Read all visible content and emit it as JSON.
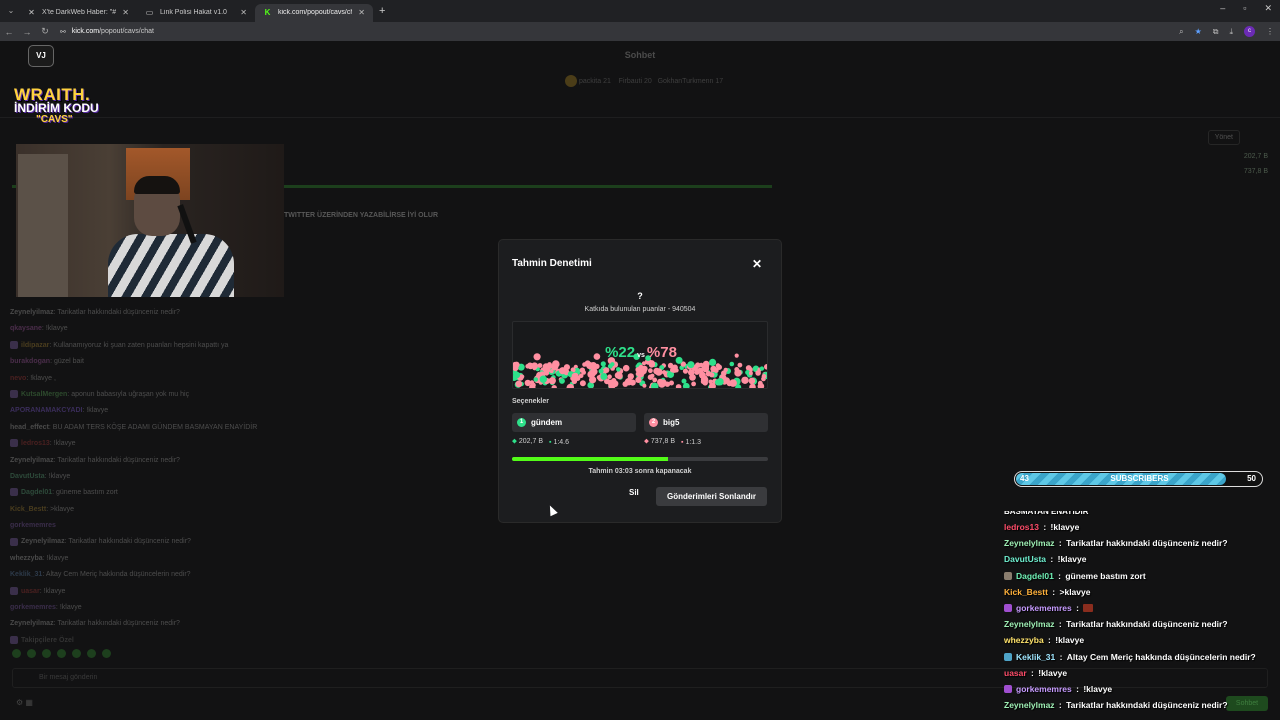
{
  "browser": {
    "tabs": [
      {
        "label": "X'te DarkWeb Haber: \"#UefaM",
        "icon": "x-logo-icon",
        "active": false
      },
      {
        "label": "Link Polisi Hakat v1.0",
        "icon": "page-icon",
        "active": false
      },
      {
        "label": "kick.com/popout/cavs/chat",
        "icon": "kick-logo-icon",
        "active": true
      }
    ],
    "new_tab": "+",
    "url_host": "kick.com",
    "url_path": "/popout/cavs/chat"
  },
  "background": {
    "title": "Sohbet",
    "leaderboard": {
      "first": {
        "name": "packita",
        "value": "21"
      },
      "others": [
        {
          "name": "Firbauti",
          "value": "20"
        },
        {
          "name": "GokhanTurkmenn",
          "value": "17"
        }
      ]
    },
    "manage_label": "Yönet",
    "amount_1": "202,7 B",
    "amount_2": "737,8 B",
    "pinned_banner": "TWITTER ÜZERİNDEN YAZABİLİRSE İYİ OLUR",
    "chat": [
      {
        "user": "Zeynelyilmaz",
        "text": "Tarikatlar hakkındaki düşünceniz nedir?",
        "color": "#4a4a4a"
      },
      {
        "user": "qkaysane",
        "text": "!klavye",
        "color": "#4a2d4a"
      },
      {
        "user": "ildipazar",
        "text": "Kullanamıyoruz ki şuan zaten puanları hepsini kapattı ya",
        "color": "#4a3d1e"
      },
      {
        "user": "burakdogan",
        "text": "güzel bait",
        "color": "#4a2d4a"
      },
      {
        "user": "nevo",
        "text": "!klavye ,",
        "color": "#4a2020"
      },
      {
        "user": "KutsalMergen",
        "text": "aponun babasıyla uğraşan yok mu hiç",
        "color": "#2d4a2d"
      },
      {
        "user": "APORANAMAKCYADI",
        "text": "!klavye",
        "color": "#3a2d5a"
      },
      {
        "user": "head_effect",
        "text": "BU ADAM TERS KÖŞE ADAMI GÜNDEM BASMAYAN ENAYİDİR",
        "color": "#4a4a4a"
      },
      {
        "user": "ledros13",
        "text": "!klavye",
        "color": "#4a2020"
      },
      {
        "user": "Zeynelyilmaz",
        "text": "Tarikatlar hakkındaki düşünceniz nedir?",
        "color": "#4a4a4a"
      },
      {
        "user": "DavutUsta",
        "text": "!klavye",
        "color": "#2d4a3a"
      },
      {
        "user": "Dagdel01",
        "text": "güneme bastım zort",
        "color": "#2d4a3a"
      },
      {
        "user": "Kick_Bestt",
        "text": ">klavye",
        "color": "#4a3d1e"
      },
      {
        "user": "gorkememres",
        "text": "",
        "color": "#3a2d4a"
      },
      {
        "user": "Zeynelyilmaz",
        "text": "Tarikatlar hakkındaki düşünceniz nedir?",
        "color": "#4a4a4a"
      },
      {
        "user": "whezzyba",
        "text": "!klavye",
        "color": "#4a4a4a"
      },
      {
        "user": "Keklik_31",
        "text": "Altay Cem Meriç hakkında düşüncelerin nedir?",
        "color": "#2d3a4a"
      },
      {
        "user": "uasar",
        "text": "!klavye",
        "color": "#4a2020"
      },
      {
        "user": "gorkememres",
        "text": "!klavye",
        "color": "#3a2d4a"
      },
      {
        "user": "Zeynelyilmaz",
        "text": "Tarikatlar hakkındaki düşünceniz nedir?",
        "color": "#4a4a4a"
      },
      {
        "user": "Takipçilere Özel",
        "text": "",
        "color": "#333333"
      }
    ],
    "input_placeholder": "Bir mesaj gönderin",
    "send_label": "Sohbet"
  },
  "overlay": {
    "logo": "VJ",
    "promo_brand": "WRAITH.",
    "promo_line": "İNDİRİM KODU",
    "promo_code": "\"CAVS\"",
    "subscribers": {
      "label": "SUBSCRIBERS",
      "current": "43",
      "goal": "50",
      "progress": 0.86
    },
    "chat_cut_text": "BASMAYAN ENAYİDİR",
    "chat": [
      {
        "user": "ledros13",
        "text": "!klavye",
        "color": "#ff4d6a",
        "badge": ""
      },
      {
        "user": "Zeynelylmaz",
        "text": "Tarikatlar hakkındaki düşünceniz nedir?",
        "color": "#9ff0b5",
        "badge": ""
      },
      {
        "user": "DavutUsta",
        "text": "!klavye",
        "color": "#6ff0d0",
        "badge": ""
      },
      {
        "user": "Dagdel01",
        "text": "güneme bastım zort",
        "color": "#6ff0b5",
        "badge": "#8a7d6e"
      },
      {
        "user": "Kick_Bestt",
        "text": ">klavye",
        "color": "#ffb13b",
        "badge": ""
      },
      {
        "user": "gorkememres",
        "text": "",
        "color": "#c79bff",
        "badge": "#a04fd0",
        "emote": true
      },
      {
        "user": "Zeynelylmaz",
        "text": "Tarikatlar hakkındaki düşünceniz nedir?",
        "color": "#9ff0b5",
        "badge": ""
      },
      {
        "user": "whezzyba",
        "text": "!klavye",
        "color": "#ffe36b",
        "badge": ""
      },
      {
        "user": "Keklik_31",
        "text": "Altay Cem Meriç hakkında düşüncelerin nedir?",
        "color": "#9fe6ff",
        "badge": "#4ea4c8"
      },
      {
        "user": "uasar",
        "text": "!klavye",
        "color": "#ff4d6a",
        "badge": ""
      },
      {
        "user": "gorkememres",
        "text": "!klavye",
        "color": "#c79bff",
        "badge": "#a04fd0"
      },
      {
        "user": "Zeynelylmaz",
        "text": "Tarikatlar hakkındaki düşünceniz nedir?",
        "color": "#9ff0b5",
        "badge": ""
      }
    ]
  },
  "modal": {
    "title": "Tahmin Denetimi",
    "question": "?",
    "contributed": "Katkıda bulunulan puanlar - 940504",
    "pct_1": "%22",
    "vs": "vs",
    "pct_2": "%78",
    "options_label": "Seçenekler",
    "options": [
      {
        "num": "1",
        "label": "gündem",
        "points": "202,7 B",
        "ratio": "1:4.6",
        "color": "#2ee08a"
      },
      {
        "num": "2",
        "label": "big5",
        "points": "737,8 B",
        "ratio": "1:1.3",
        "color": "#ff8fa1"
      }
    ],
    "time_progress": 0.61,
    "closing_text": "Tahmin 03:03 sonra kapanacak",
    "delete_label": "Sil",
    "end_label": "Gönderimleri Sonlandır"
  }
}
